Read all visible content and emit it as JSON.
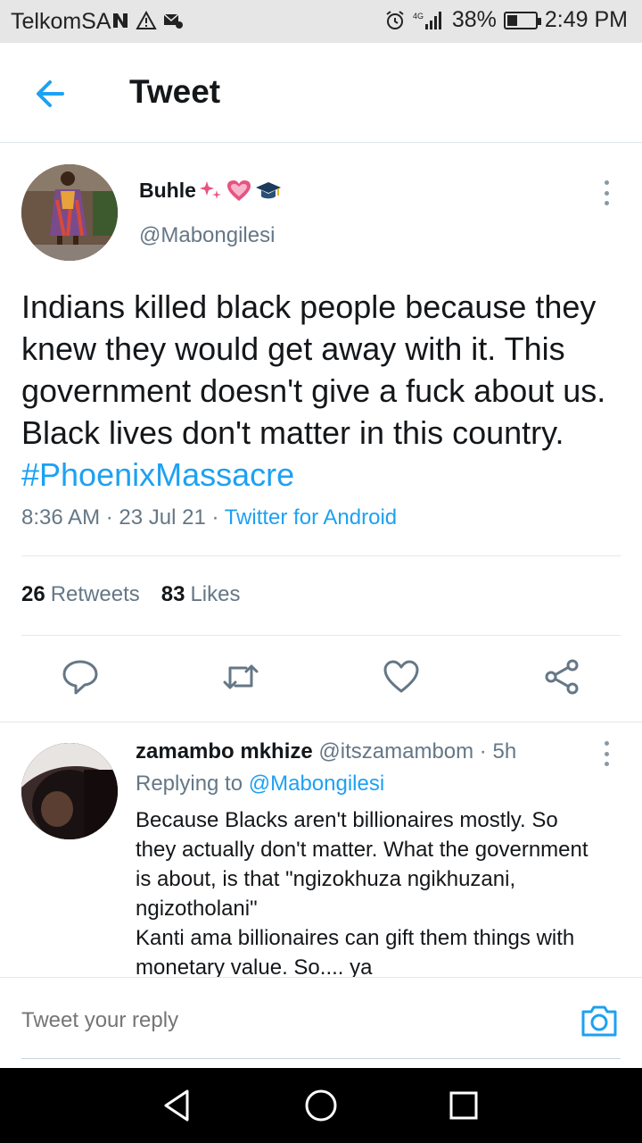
{
  "status_bar": {
    "carrier": "TelkomSA",
    "battery_percent": "38%",
    "battery_level": 0.38,
    "time": "2:49 PM",
    "network": "4G"
  },
  "header": {
    "title": "Tweet"
  },
  "tweet": {
    "author_name": "Buhle",
    "author_handle": "@Mabongilesi",
    "text": "Indians killed black people because they knew they would get away with it.  This government doesn't give a fuck about us. Black lives don't matter in this country.  ",
    "hashtag": "#PhoenixMassacre",
    "time": "8:36 AM",
    "date": "23 Jul 21",
    "source": "Twitter for Android",
    "retweets_count": "26",
    "retweets_label": "Retweets",
    "likes_count": "83",
    "likes_label": "Likes"
  },
  "reply": {
    "author_name": "zamambo mkhize",
    "author_handle": "@itszamambom",
    "age": "5h",
    "replying_to_label": "Replying to",
    "replying_to_handle": "@Mabongilesi",
    "text_lines": [
      "Because Blacks aren't billionaires mostly.  So",
      "they actually don't matter.  What the government",
      "is about,  is that \"ngizokhuza ngikhuzani,",
      "ngizotholani\"",
      "Kanti ama billionaires can gift them things with",
      "monetary value. So.... ya"
    ]
  },
  "compose": {
    "placeholder": "Tweet your reply"
  },
  "colors": {
    "accent": "#1da1f2",
    "secondary_text": "#657786",
    "primary_text": "#14171a",
    "divider": "#e1e8ed"
  }
}
